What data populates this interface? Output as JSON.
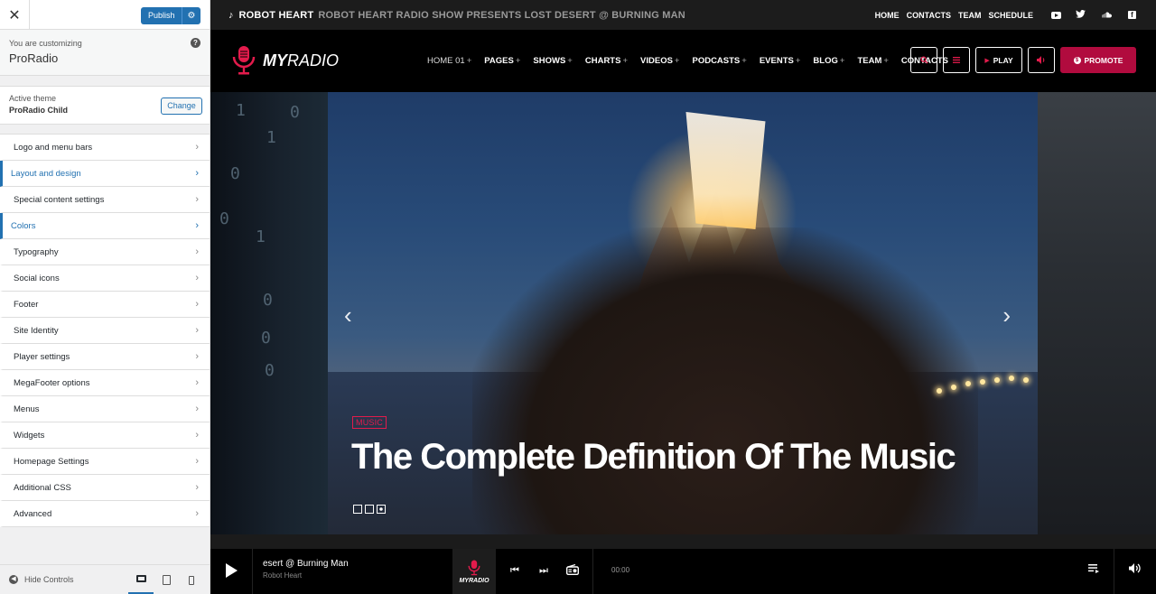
{
  "customizer": {
    "close_icon": "close-icon",
    "publish_label": "Publish",
    "publish_settings_icon": "gear-icon",
    "customizing_label": "You are customizing",
    "site_name": "ProRadio",
    "help_icon": "?",
    "active_theme_label": "Active theme",
    "active_theme_name": "ProRadio Child",
    "change_label": "Change",
    "sections": [
      {
        "label": "Logo and menu bars",
        "active": false
      },
      {
        "label": "Layout and design",
        "active": true
      },
      {
        "label": "Special content settings",
        "active": false
      },
      {
        "label": "Colors",
        "active": true
      },
      {
        "label": "Typography",
        "active": false
      },
      {
        "label": "Social icons",
        "active": false
      },
      {
        "label": "Footer",
        "active": false
      },
      {
        "label": "Site Identity",
        "active": false
      },
      {
        "label": "Player settings",
        "active": false
      },
      {
        "label": "MegaFooter options",
        "active": false
      },
      {
        "label": "Menus",
        "active": false
      },
      {
        "label": "Widgets",
        "active": false
      },
      {
        "label": "Homepage Settings",
        "active": false
      },
      {
        "label": "Additional CSS",
        "active": false
      },
      {
        "label": "Advanced",
        "active": false
      }
    ],
    "hide_controls_label": "Hide Controls",
    "active_color": "#2271b1"
  },
  "site": {
    "topbar": {
      "ticker_artist": "ROBOT HEART",
      "ticker_title": "ROBOT HEART RADIO SHOW PRESENTS LOST DESERT @ BURNING MAN",
      "links": [
        "HOME",
        "CONTACTS",
        "TEAM",
        "SCHEDULE"
      ],
      "social_icons": [
        "youtube-icon",
        "twitter-icon",
        "soundcloud-icon",
        "facebook-icon"
      ]
    },
    "logo": {
      "bold": "MY",
      "light": "RADIO"
    },
    "menu": [
      {
        "label": "HOME 01",
        "plus": "+"
      },
      {
        "label": "PAGES",
        "plus": "+"
      },
      {
        "label": "SHOWS",
        "plus": "+"
      },
      {
        "label": "CHARTS",
        "plus": "+"
      },
      {
        "label": "VIDEOS",
        "plus": "+"
      },
      {
        "label": "PODCASTS",
        "plus": "+"
      },
      {
        "label": "EVENTS",
        "plus": "+"
      },
      {
        "label": "BLOG",
        "plus": "+"
      },
      {
        "label": "TEAM",
        "plus": "+"
      },
      {
        "label": "CONTACTS",
        "plus": ""
      }
    ],
    "buttons": {
      "play_label": "PLAY",
      "promote_label": "PROMOTE"
    },
    "brand_color": "#e31b4c",
    "promote_color": "#b10b3e",
    "hero": {
      "tag": "MUSIC",
      "headline": "The Complete Definition Of The Music",
      "slide_count": 3,
      "current_slide": 3
    },
    "player": {
      "track_title": "esert @ Burning Man",
      "artist": "Robot Heart",
      "logo_text": "MYRADIO",
      "time": "00:00"
    }
  }
}
